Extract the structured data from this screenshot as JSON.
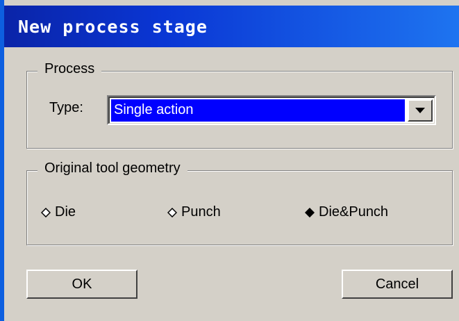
{
  "window": {
    "title": "New process stage"
  },
  "process": {
    "legend": "Process",
    "type_label": "Type:",
    "type_value": "Single action"
  },
  "geometry": {
    "legend": "Original tool geometry",
    "options": [
      {
        "label": "Die",
        "selected": false
      },
      {
        "label": "Punch",
        "selected": false
      },
      {
        "label": "Die&Punch",
        "selected": true
      }
    ]
  },
  "buttons": {
    "ok": "OK",
    "cancel": "Cancel"
  },
  "colors": {
    "title_bar": "#0a36d4",
    "dialog_bg": "#d4d0c8",
    "selection": "#0000ff"
  }
}
